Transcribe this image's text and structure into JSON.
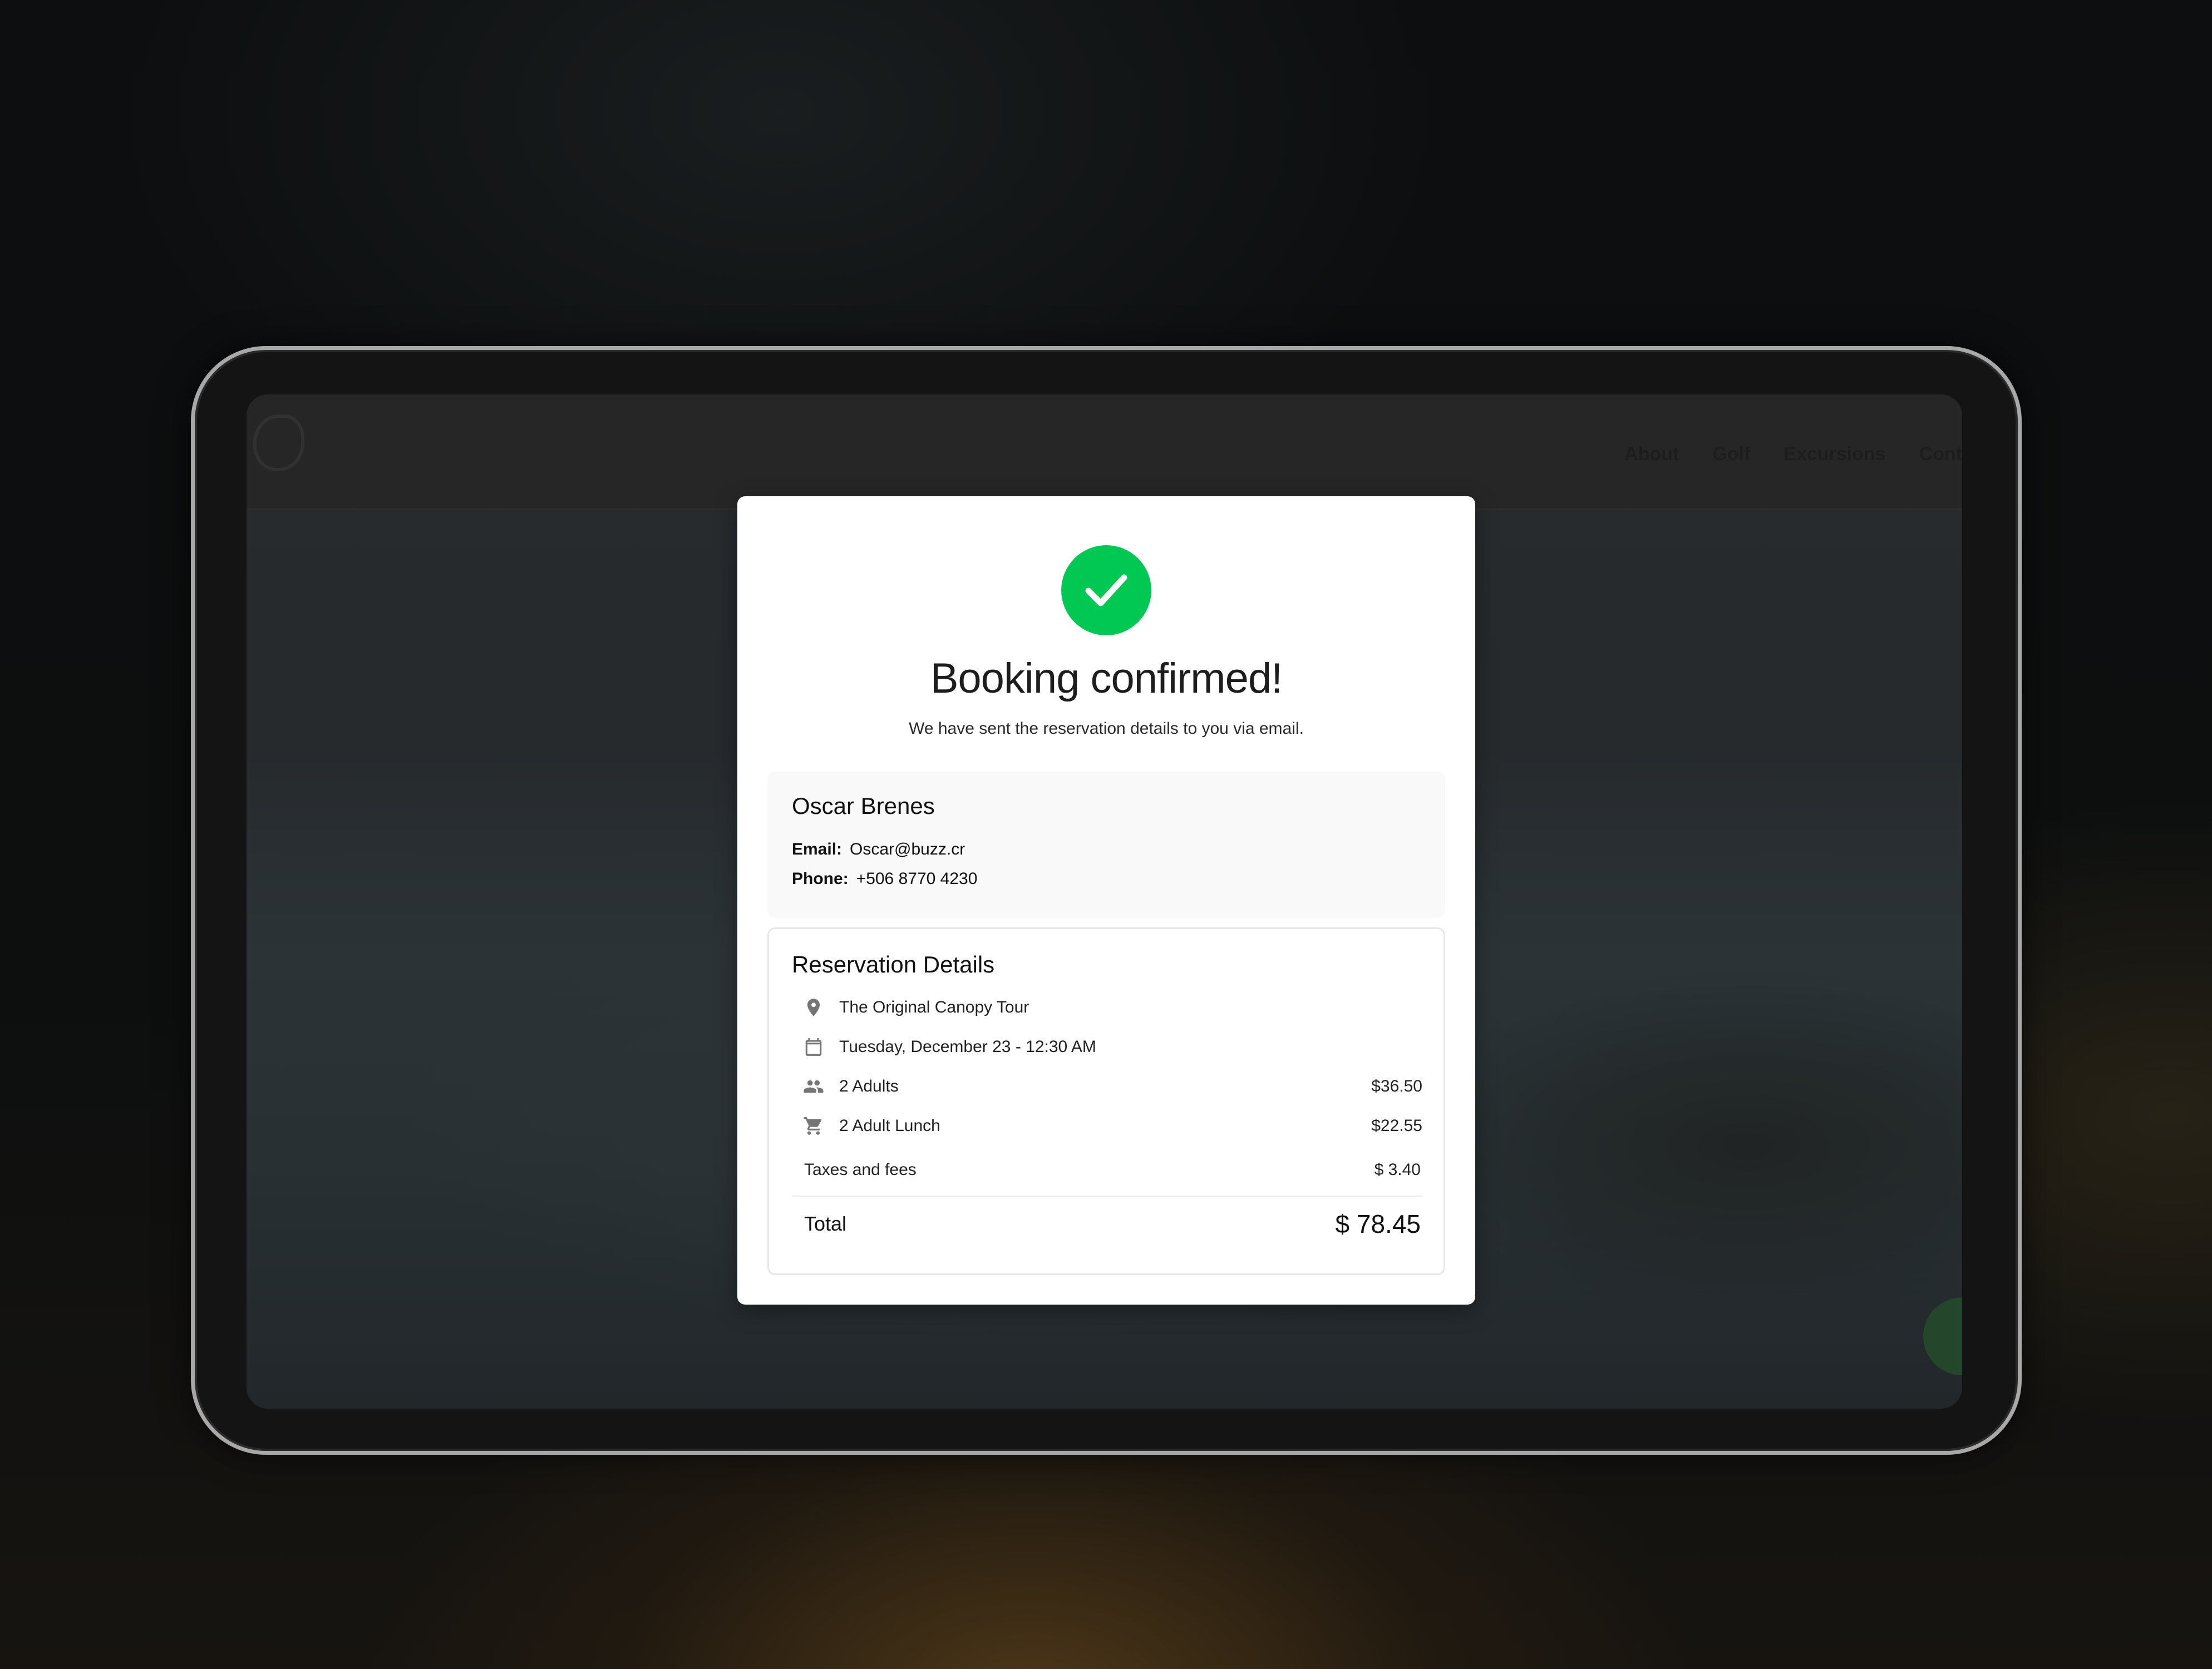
{
  "site": {
    "nav": [
      "About",
      "Golf",
      "Excursions",
      "Cont"
    ]
  },
  "modal": {
    "status_icon": "check-icon",
    "title": "Booking confirmed!",
    "subtitle": "We have sent the reservation details to you via email.",
    "accent_color": "#00c853"
  },
  "customer": {
    "name": "Oscar Brenes",
    "email_label": "Email:",
    "email": "Oscar@buzz.cr",
    "phone_label": "Phone:",
    "phone": "+506 8770 4230"
  },
  "reservation": {
    "title": "Reservation Details",
    "items": [
      {
        "icon": "location-pin-icon",
        "text": "The Original Canopy Tour",
        "price": ""
      },
      {
        "icon": "calendar-icon",
        "text": "Tuesday, December 23 - 12:30 AM",
        "price": ""
      },
      {
        "icon": "people-icon",
        "text": "2 Adults",
        "price": "$36.50"
      },
      {
        "icon": "cart-icon",
        "text": "2 Adult Lunch",
        "price": "$22.55"
      }
    ],
    "fees_label": "Taxes and fees",
    "fees_value": "$ 3.40",
    "total_label": "Total",
    "total_value": "$ 78.45"
  }
}
